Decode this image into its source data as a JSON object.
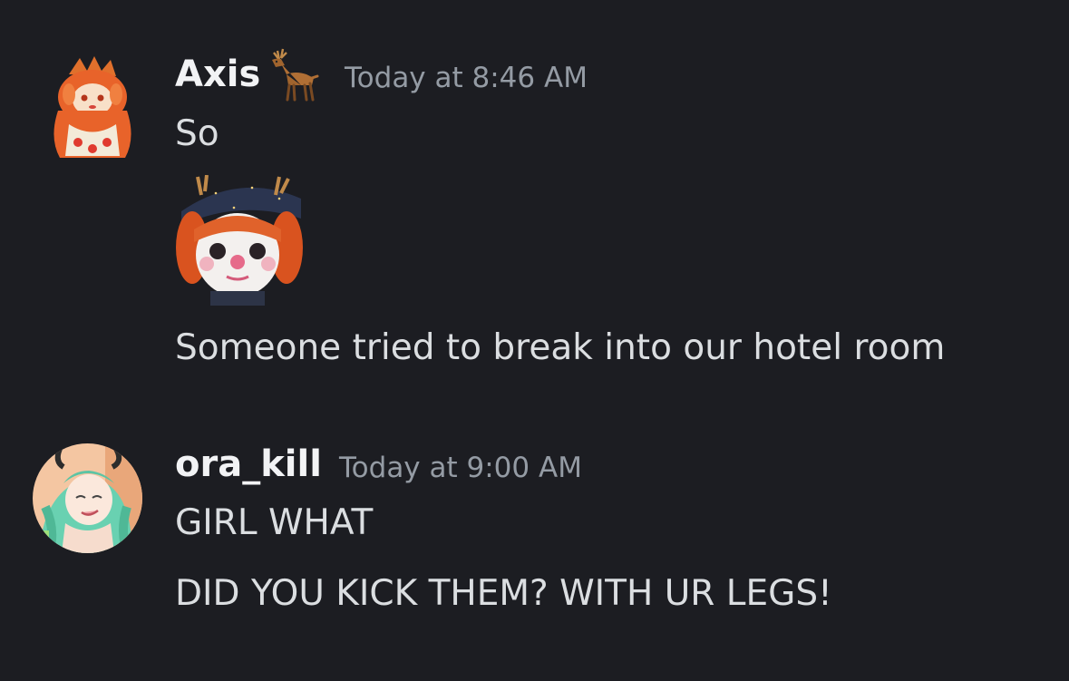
{
  "messages": [
    {
      "author": "Axis",
      "author_badge": "reindeer-emoji",
      "timestamp": "Today at 8:46 AM",
      "lines": [
        "So",
        "Someone tried to break into our hotel room"
      ],
      "sticker": "clown-avatar-sticker"
    },
    {
      "author": "ora_kill",
      "timestamp": "Today at 9:00 AM",
      "lines": [
        "GIRL WHAT",
        "DID YOU KICK THEM? WITH UR LEGS!"
      ]
    }
  ],
  "colors": {
    "background": "#1c1d22",
    "username": "#f2f3f5",
    "timestamp": "#949ba4",
    "message_text": "#dbdee1"
  }
}
